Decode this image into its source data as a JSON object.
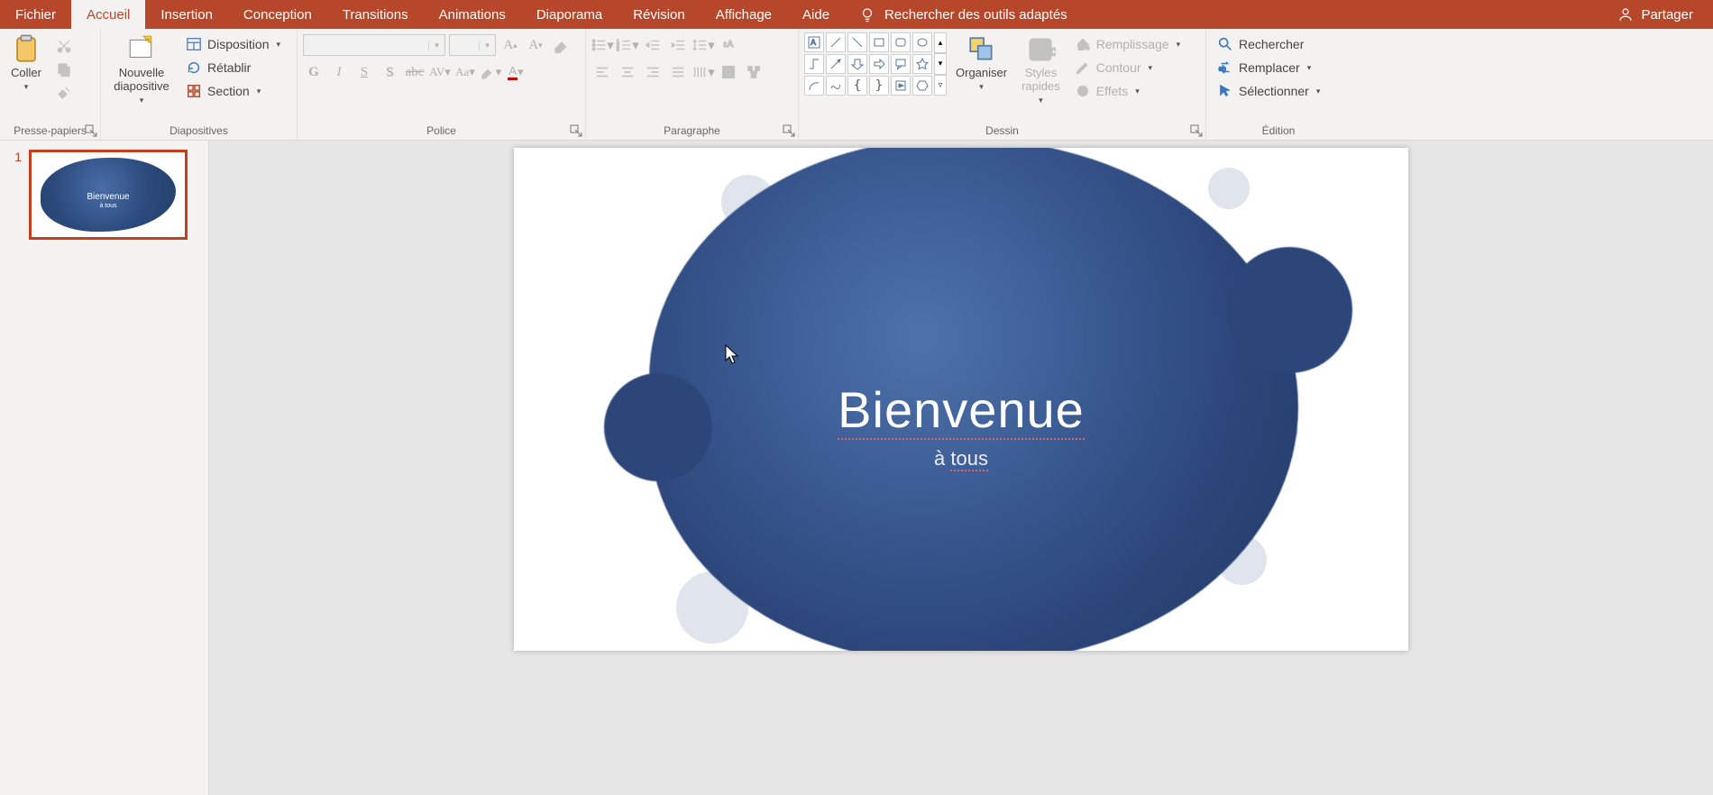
{
  "tabs": {
    "file": "Fichier",
    "home": "Accueil",
    "insert": "Insertion",
    "design": "Conception",
    "transitions": "Transitions",
    "animations": "Animations",
    "slideshow": "Diaporama",
    "review": "Révision",
    "view": "Affichage",
    "help": "Aide",
    "tell_me": "Rechercher des outils adaptés",
    "share": "Partager"
  },
  "groups": {
    "clipboard": {
      "label": "Presse-papiers",
      "paste": "Coller"
    },
    "slides": {
      "label": "Diapositives",
      "new_slide": "Nouvelle\ndiapositive",
      "layout": "Disposition",
      "reset": "Rétablir",
      "section": "Section"
    },
    "font": {
      "label": "Police",
      "font_name": "",
      "font_size": ""
    },
    "paragraph": {
      "label": "Paragraphe"
    },
    "drawing": {
      "label": "Dessin",
      "arrange": "Organiser",
      "quick_styles": "Styles\nrapides",
      "fill": "Remplissage",
      "outline": "Contour",
      "effects": "Effets"
    },
    "editing": {
      "label": "Édition",
      "find": "Rechercher",
      "replace": "Remplacer",
      "select": "Sélectionner"
    }
  },
  "slide": {
    "number": "1",
    "title": "Bienvenue",
    "subtitle_prefix": "à ",
    "subtitle_word": "tous",
    "thumb_title": "Bienvenue",
    "thumb_sub": "à tous"
  }
}
